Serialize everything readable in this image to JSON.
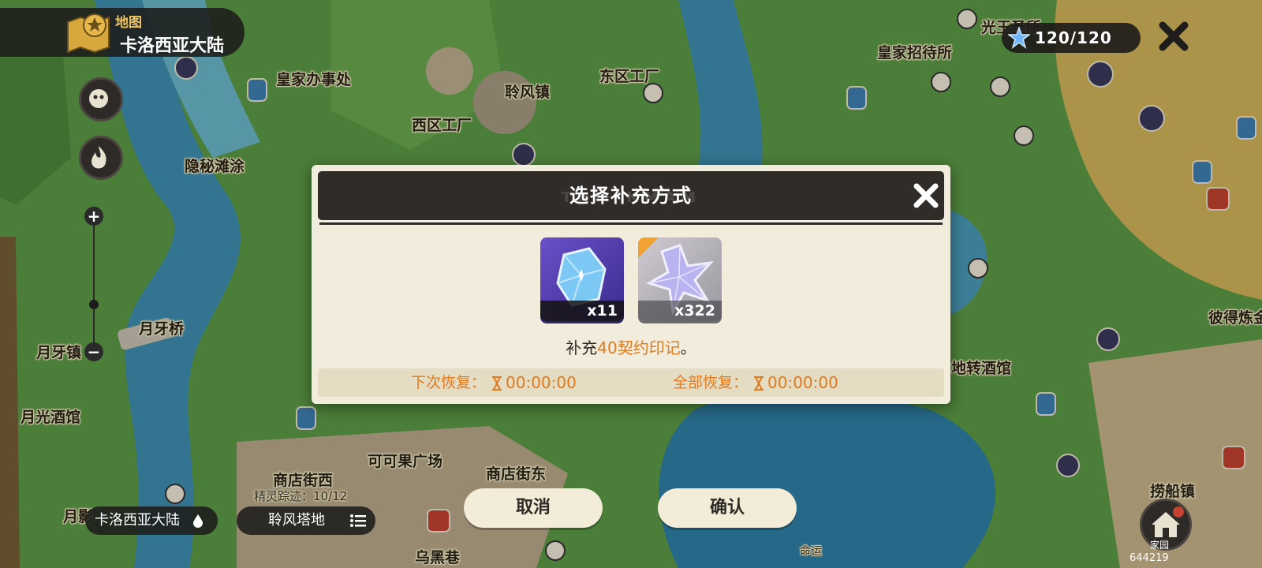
{
  "header": {
    "map_sub": "地图",
    "region": "卡洛西亚大陆"
  },
  "top_right": {
    "energy": "120/120"
  },
  "map_labels": [
    {
      "text": "皇家办事处"
    },
    {
      "text": "聆风镇"
    },
    {
      "text": "东区工厂"
    },
    {
      "text": "西区工厂"
    },
    {
      "text": "隐秘滩涂"
    },
    {
      "text": "皇家招待所"
    },
    {
      "text": "光王圣所"
    },
    {
      "text": "月牙桥"
    },
    {
      "text": "月牙镇"
    },
    {
      "text": "月光酒馆"
    },
    {
      "text": "商店街西"
    },
    {
      "text": "可可果广场"
    },
    {
      "text": "商店街东"
    },
    {
      "text": "乌黑巷"
    },
    {
      "text": "地转酒馆"
    },
    {
      "text": "彼得炼金"
    },
    {
      "text": "捞船镇"
    },
    {
      "text": "月影"
    },
    {
      "text": "命运"
    }
  ],
  "bottom": {
    "trace": "精灵踪迹：10/12",
    "region_button": "卡洛西亚大陆",
    "location_button": "聆风塔地",
    "cancel": "取消",
    "confirm": "确认",
    "home": "家园",
    "uid": "644219"
  },
  "dialog": {
    "title": "选择补充方式",
    "watermark": "ᴛʜᴍ             ᴋᴍᴀᴍ",
    "items": [
      {
        "name": "blue-crystal",
        "count": "x11"
      },
      {
        "name": "star-crystal",
        "count": "x322"
      }
    ],
    "desc_prefix": "补充",
    "desc_highlight": "40契约印记",
    "desc_suffix": "。",
    "next_label": "下次恢复：",
    "next_time": "00:00:00",
    "all_label": "全部恢复：",
    "all_time": "00:00:00"
  },
  "colors": {
    "accent_orange": "#e07a1d",
    "dark_panel": "#2f2c29",
    "dialog_bg": "#f2ecdc"
  }
}
